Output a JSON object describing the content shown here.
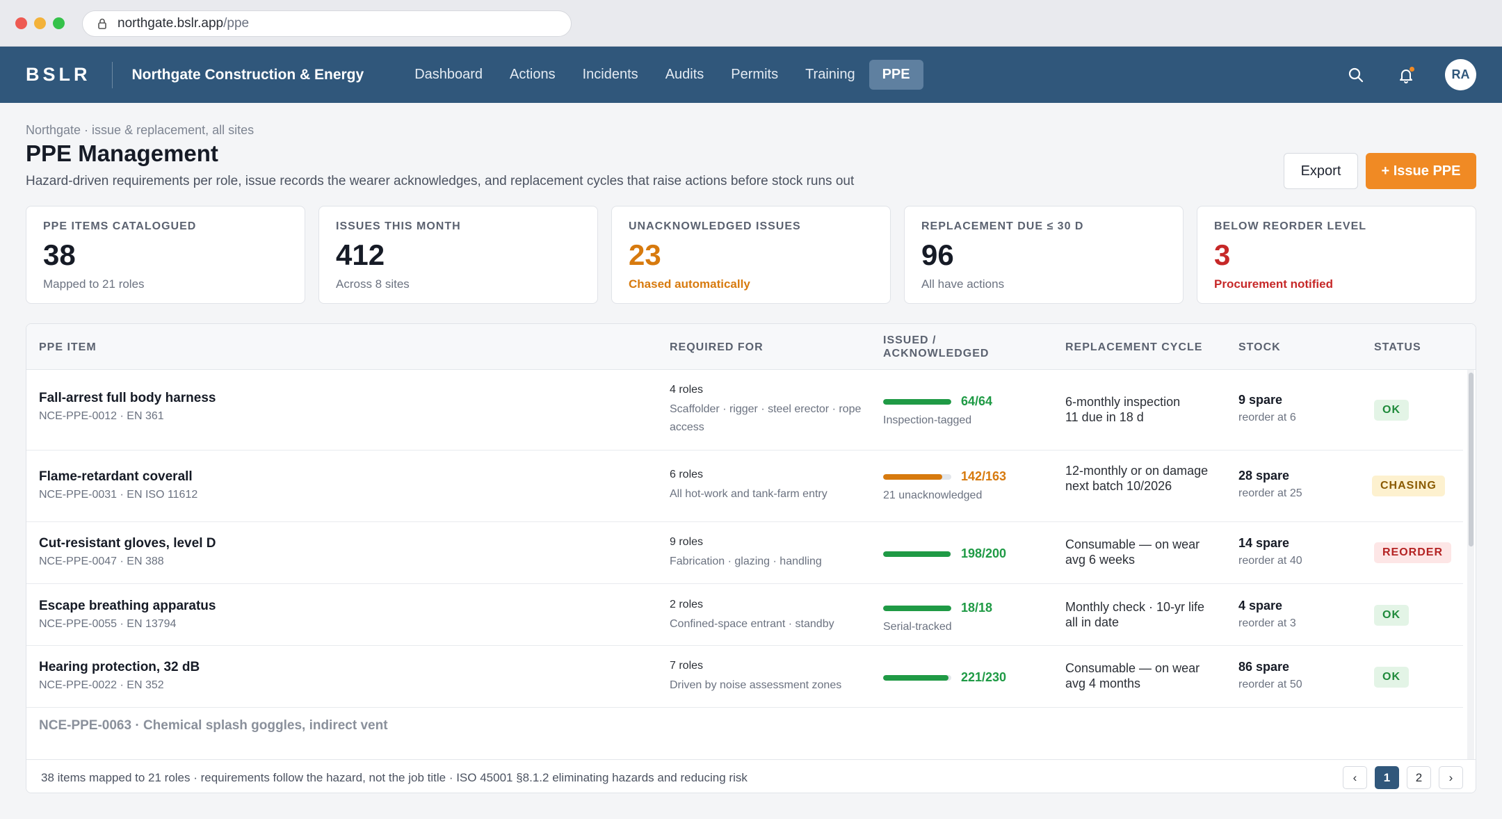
{
  "browser": {
    "url_host": "northgate.bslr.app",
    "url_path": "/ppe"
  },
  "header": {
    "brand": "BSLR",
    "org": "Northgate Construction & Energy",
    "nav": [
      "Dashboard",
      "Actions",
      "Incidents",
      "Audits",
      "Permits",
      "Training",
      "PPE"
    ],
    "active_nav": "PPE",
    "avatar": "RA"
  },
  "page": {
    "breadcrumb": "Northgate · issue & replacement, all sites",
    "title": "PPE Management",
    "subtitle": "Hazard-driven requirements per role, issue records the wearer acknowledges, and replacement cycles that raise actions before stock runs out",
    "export_label": "Export",
    "issue_label": "+ Issue PPE"
  },
  "kpis": [
    {
      "label": "PPE ITEMS CATALOGUED",
      "value": "38",
      "note": "Mapped to 21 roles"
    },
    {
      "label": "ISSUES THIS MONTH",
      "value": "412",
      "note": "Across 8 sites"
    },
    {
      "label": "UNACKNOWLEDGED ISSUES",
      "value": "23",
      "note": "Chased automatically"
    },
    {
      "label": "REPLACEMENT DUE ≤ 30 D",
      "value": "96",
      "note": "All have actions"
    },
    {
      "label": "BELOW REORDER LEVEL",
      "value": "3",
      "note": "Procurement notified"
    }
  ],
  "table": {
    "headers": {
      "item": "PPE ITEM",
      "required": "REQUIRED FOR",
      "issued_1": "ISSUED /",
      "issued_2": "ACKNOWLEDGED",
      "cycle": "REPLACEMENT CYCLE",
      "stock": "STOCK",
      "status": "STATUS"
    },
    "rows": [
      {
        "name": "Fall-arrest full body harness",
        "code": "NCE-PPE-0012 · EN 361",
        "roles_count": "4 roles",
        "roles": "Scaffolder · rigger · steel erector · rope access",
        "issued": "64/64",
        "ack_fraction": 1.0,
        "issued_note": "Inspection-tagged",
        "cycle_1": "6-monthly inspection",
        "cycle_2": "11 due in 18 d",
        "stock": "9 spare",
        "reorder": "reorder at 6",
        "status": "OK"
      },
      {
        "name": "Flame-retardant coverall",
        "code": "NCE-PPE-0031 · EN ISO 11612",
        "roles_count": "6 roles",
        "roles": "All hot-work and tank-farm entry",
        "issued": "142/163",
        "ack_fraction": 0.871,
        "issued_note": "21 unacknowledged",
        "cycle_1": "12-monthly or on damage",
        "cycle_2": "next batch 10/2026",
        "stock": "28 spare",
        "reorder": "reorder at 25",
        "status": "CHASING"
      },
      {
        "name": "Cut-resistant gloves, level D",
        "code": "NCE-PPE-0047 · EN 388",
        "roles_count": "9 roles",
        "roles": "Fabrication · glazing · handling",
        "issued": "198/200",
        "ack_fraction": 0.99,
        "issued_note": "",
        "cycle_1": "Consumable — on wear",
        "cycle_2": "avg 6 weeks",
        "stock": "14 spare",
        "reorder": "reorder at 40",
        "status": "REORDER"
      },
      {
        "name": "Escape breathing apparatus",
        "code": "NCE-PPE-0055 · EN 13794",
        "roles_count": "2 roles",
        "roles": "Confined-space entrant · standby",
        "issued": "18/18",
        "ack_fraction": 1.0,
        "issued_note": "Serial-tracked",
        "cycle_1": "Monthly check · 10-yr life",
        "cycle_2": "all in date",
        "stock": "4 spare",
        "reorder": "reorder at 3",
        "status": "OK"
      },
      {
        "name": "Hearing protection, 32 dB",
        "code": "NCE-PPE-0022 · EN 352",
        "roles_count": "7 roles",
        "roles": "Driven by noise assessment zones",
        "issued": "221/230",
        "ack_fraction": 0.961,
        "issued_note": "",
        "cycle_1": "Consumable — on wear",
        "cycle_2": "avg 4 months",
        "stock": "86 spare",
        "reorder": "reorder at 50",
        "status": "OK"
      }
    ],
    "partial_row": "NCE-PPE-0063 · Chemical splash goggles, indirect vent",
    "footer": "38 items mapped to 21 roles · requirements follow the hazard, not the job title · ISO 45001 §8.1.2 eliminating hazards and reducing risk",
    "pages": [
      "‹",
      "1",
      "2",
      "›"
    ],
    "current_page": "1"
  },
  "colors": {
    "header_bg": "#30577b",
    "accent": "#f08a24",
    "ok_green": "#1f9a45",
    "warn_orange": "#d77a0e",
    "alert_red": "#c62828"
  }
}
